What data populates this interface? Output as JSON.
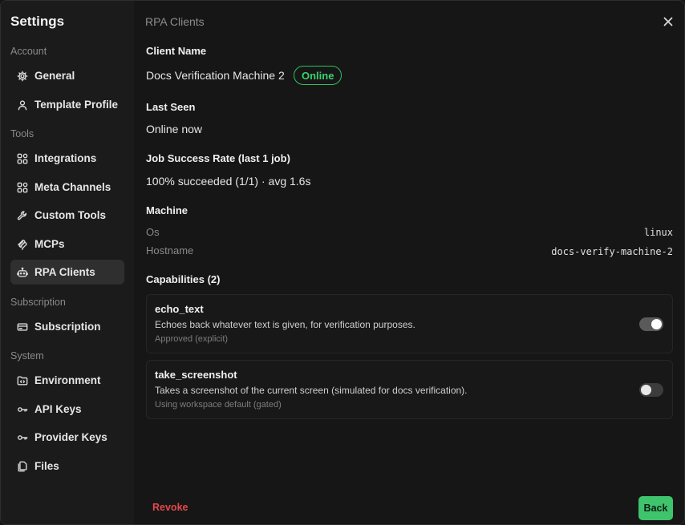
{
  "sidebar": {
    "title": "Settings",
    "sections": {
      "account": "Account",
      "tools": "Tools",
      "subscription": "Subscription",
      "system": "System"
    },
    "items": {
      "general": {
        "label": "General",
        "icon": "gear-icon"
      },
      "template_profile": {
        "label": "Template Profile",
        "icon": "user-icon"
      },
      "integrations": {
        "label": "Integrations",
        "icon": "grid-icon"
      },
      "meta_channels": {
        "label": "Meta Channels",
        "icon": "grid-icon"
      },
      "custom_tools": {
        "label": "Custom Tools",
        "icon": "wrench-icon"
      },
      "mcps": {
        "label": "MCPs",
        "icon": "mcp-icon"
      },
      "rpa_clients": {
        "label": "RPA Clients",
        "icon": "robot-icon",
        "active": true
      },
      "subscription": {
        "label": "Subscription",
        "icon": "credit-card-icon"
      },
      "environment": {
        "label": "Environment",
        "icon": "folder-code-icon"
      },
      "api_keys": {
        "label": "API Keys",
        "icon": "key-icon"
      },
      "provider_keys": {
        "label": "Provider Keys",
        "icon": "key-icon"
      },
      "files": {
        "label": "Files",
        "icon": "files-icon"
      }
    }
  },
  "panel": {
    "title": "RPA Clients",
    "client_name_label": "Client Name",
    "client_name": "Docs Verification Machine 2",
    "status_badge": "Online",
    "last_seen_label": "Last Seen",
    "last_seen": "Online now",
    "success_rate_label": "Job Success Rate (last 1 job)",
    "success_rate": "100% succeeded (1/1) · avg 1.6s",
    "machine_label": "Machine",
    "machine": {
      "os_key": "Os",
      "os_val": "linux",
      "hostname_key": "Hostname",
      "hostname_val": "docs-verify-machine-2"
    },
    "capabilities_label": "Capabilities (2)",
    "capabilities": [
      {
        "name": "echo_text",
        "description": "Echoes back whatever text is given, for verification purposes.",
        "status": "Approved (explicit)",
        "enabled": true
      },
      {
        "name": "take_screenshot",
        "description": "Takes a screenshot of the current screen (simulated for docs verification).",
        "status": "Using workspace default (gated)",
        "enabled": false
      }
    ],
    "revoke_label": "Revoke",
    "back_label": "Back"
  },
  "colors": {
    "accent_green": "#3ec46d",
    "online_green": "#3bd16f",
    "danger_red": "#e5484d"
  }
}
